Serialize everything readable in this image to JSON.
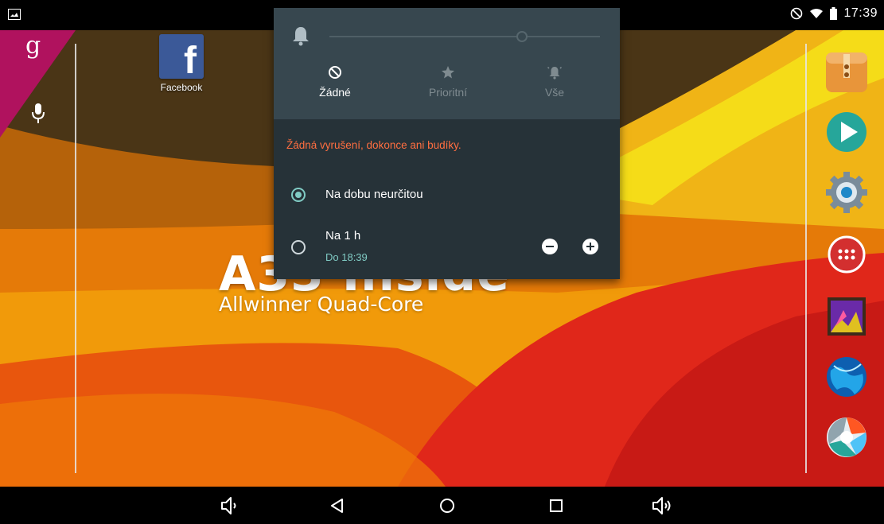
{
  "status_bar": {
    "time": "17:39",
    "icons": [
      "screenshot-icon",
      "dnd-icon",
      "wifi-icon",
      "battery-icon"
    ]
  },
  "home": {
    "apps": [
      {
        "label": "Facebook",
        "icon": "facebook-icon"
      }
    ],
    "wallpaper_title": "A33 Inside",
    "wallpaper_subtitle": "Allwinner Quad-Core",
    "dock": [
      "archive-app-icon",
      "play-store-icon",
      "settings-icon",
      "all-apps-icon",
      "gallery-icon",
      "browser-icon",
      "camera-icon"
    ]
  },
  "panel": {
    "volume_icon": "bell-icon",
    "modes": [
      {
        "label": "Žádné",
        "icon": "no-interruptions-icon",
        "active": true
      },
      {
        "label": "Prioritní",
        "icon": "star-icon",
        "active": false
      },
      {
        "label": "Vše",
        "icon": "bell-ring-icon",
        "active": false
      }
    ],
    "description": "Žádná vyrušení, dokonce ani budíky.",
    "options": [
      {
        "label": "Na dobu neurčitou",
        "selected": true
      },
      {
        "label": "Na 1 h",
        "sublabel": "Do 18:39",
        "selected": false
      }
    ]
  },
  "nav_bar": [
    "volume-down-icon",
    "back-icon",
    "home-icon",
    "recents-icon",
    "volume-up-icon"
  ],
  "colors": {
    "panel_bg": "#263238",
    "panel_header_bg": "#37474f",
    "accent": "#80cbc4",
    "warning": "#ff6e40"
  }
}
